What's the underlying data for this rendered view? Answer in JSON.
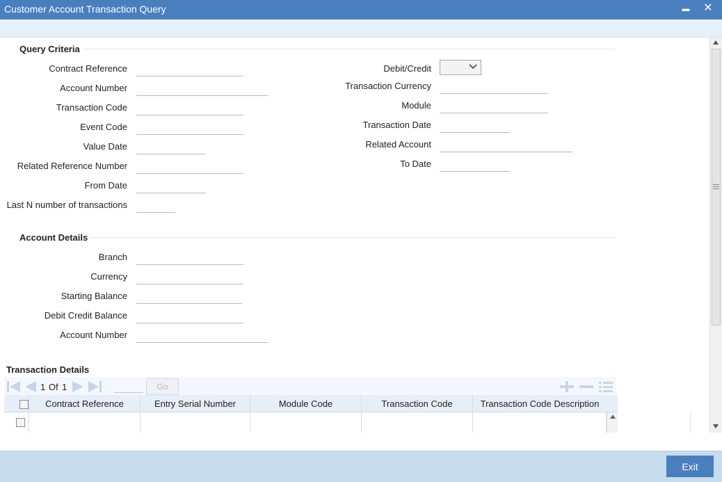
{
  "window": {
    "title": "Customer Account Transaction Query",
    "minimize_glyph": "▬",
    "close_glyph": "✕"
  },
  "query_criteria": {
    "title": "Query Criteria",
    "left_fields": [
      {
        "label": "Contract Reference",
        "value": ""
      },
      {
        "label": "Account Number",
        "value": ""
      },
      {
        "label": "Transaction Code",
        "value": ""
      },
      {
        "label": "Event Code",
        "value": ""
      },
      {
        "label": "Value Date",
        "value": ""
      },
      {
        "label": "Related Reference Number",
        "value": ""
      },
      {
        "label": "From Date",
        "value": ""
      },
      {
        "label": "Last N number of transactions",
        "value": ""
      }
    ],
    "right_fields": [
      {
        "label": "Debit/Credit",
        "value": ""
      },
      {
        "label": "Transaction Currency",
        "value": ""
      },
      {
        "label": "Module",
        "value": ""
      },
      {
        "label": "Transaction Date",
        "value": ""
      },
      {
        "label": "Related Account",
        "value": ""
      },
      {
        "label": "To Date",
        "value": ""
      }
    ]
  },
  "account_details": {
    "title": "Account Details",
    "fields": [
      {
        "label": "Branch",
        "value": ""
      },
      {
        "label": "Currency",
        "value": ""
      },
      {
        "label": "Starting Balance",
        "value": ""
      },
      {
        "label": "Debit Credit Balance",
        "value": ""
      },
      {
        "label": "Account Number",
        "value": ""
      }
    ]
  },
  "transaction_details": {
    "title": "Transaction Details",
    "pager": {
      "current": "1",
      "of_label": "Of",
      "total": "1",
      "go_label": "Go"
    },
    "columns": [
      "Contract Reference",
      "Entry Serial Number",
      "Module Code",
      "Transaction Code",
      "Transaction Code Description"
    ]
  },
  "footer": {
    "exit_label": "Exit"
  },
  "colors": {
    "titlebar": "#4a7fbf",
    "footer": "#c7dced",
    "accent": "#4a7fbf"
  }
}
